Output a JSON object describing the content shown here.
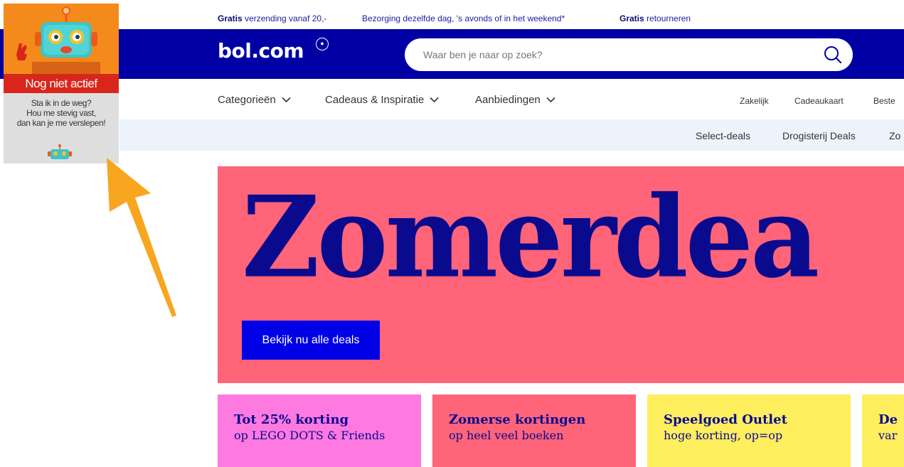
{
  "topbar": {
    "usp1_bold": "Gratis",
    "usp1_text": " verzending vanaf 20,-",
    "usp2_text": "Bezorging dezelfde dag, 's avonds of in het weekend*",
    "usp3_bold": "Gratis",
    "usp3_text": " retourneren"
  },
  "header": {
    "logo": "bol.com",
    "search_placeholder": "Waar ben je naar op zoek?"
  },
  "nav": {
    "categories": "Categorieën",
    "gifts": "Cadeaus & Inspiratie",
    "offers": "Aanbiedingen",
    "business": "Zakelijk",
    "giftcard": "Cadeaukaart",
    "bestsellers": "Beste"
  },
  "subnav": {
    "item1": "Select-deals",
    "item2": "Drogisterij Deals",
    "item3": "Zo"
  },
  "hero": {
    "title": "Zomerdea",
    "button": "Bekijk nu alle deals"
  },
  "tiles": [
    {
      "title": "Tot 25% korting",
      "subtitle": "op LEGO DOTS & Friends",
      "color": "#ff7ae0"
    },
    {
      "title": "Zomerse kortingen",
      "subtitle": "op heel veel boeken",
      "color": "#ff6479"
    },
    {
      "title": "Speelgoed Outlet",
      "subtitle": "hoge korting, op=op",
      "color": "#ffee5e"
    },
    {
      "title": "De",
      "subtitle": "var",
      "color": "#ffee5e"
    }
  ],
  "widget": {
    "status": "Nog niet actief",
    "line1": "Sta ik in de weg?",
    "line2": "Hou me stevig vast,",
    "line3": "dan kan je me verslepen!"
  },
  "colors": {
    "brand_blue": "#0000a4",
    "hero_pink": "#ff6479",
    "cta_blue": "#0000e6",
    "widget_orange": "#f48a1c",
    "widget_red": "#d8261b",
    "arrow": "#f8a51f"
  }
}
